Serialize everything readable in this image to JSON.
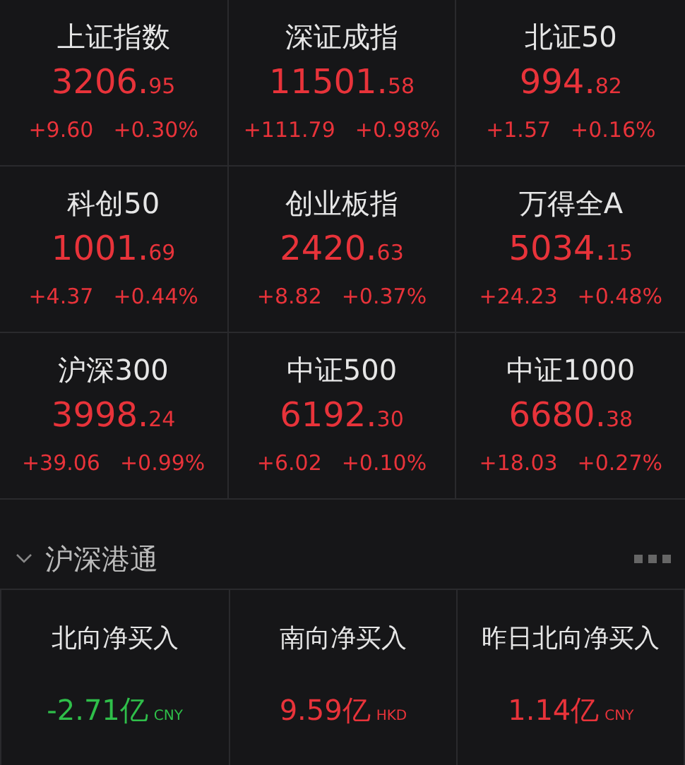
{
  "indices": [
    {
      "name": "上证指数",
      "price_int": "3206.",
      "price_dec": "95",
      "change": "+9.60",
      "percent": "+0.30%",
      "color": "#e8333a"
    },
    {
      "name": "深证成指",
      "price_int": "11501.",
      "price_dec": "58",
      "change": "+111.79",
      "percent": "+0.98%",
      "color": "#e8333a"
    },
    {
      "name": "北证50",
      "price_int": "994.",
      "price_dec": "82",
      "change": "+1.57",
      "percent": "+0.16%",
      "color": "#e8333a"
    },
    {
      "name": "科创50",
      "price_int": "1001.",
      "price_dec": "69",
      "change": "+4.37",
      "percent": "+0.44%",
      "color": "#e8333a"
    },
    {
      "name": "创业板指",
      "price_int": "2420.",
      "price_dec": "63",
      "change": "+8.82",
      "percent": "+0.37%",
      "color": "#e8333a"
    },
    {
      "name": "万得全A",
      "price_int": "5034.",
      "price_dec": "15",
      "change": "+24.23",
      "percent": "+0.48%",
      "color": "#e8333a"
    },
    {
      "name": "沪深300",
      "price_int": "3998.",
      "price_dec": "24",
      "change": "+39.06",
      "percent": "+0.99%",
      "color": "#e8333a"
    },
    {
      "name": "中证500",
      "price_int": "6192.",
      "price_dec": "30",
      "change": "+6.02",
      "percent": "+0.10%",
      "color": "#e8333a"
    },
    {
      "name": "中证1000",
      "price_int": "6680.",
      "price_dec": "38",
      "change": "+18.03",
      "percent": "+0.27%",
      "color": "#e8333a"
    }
  ],
  "section": {
    "title": "沪深港通",
    "expanded": true
  },
  "flows": [
    {
      "label": "北向净买入",
      "value": "-2.71亿",
      "currency": "CNY",
      "color": "#2fbf4a"
    },
    {
      "label": "南向净买入",
      "value": "9.59亿",
      "currency": "HKD",
      "color": "#e8333a"
    },
    {
      "label": "昨日北向净买入",
      "value": "1.14亿",
      "currency": "CNY",
      "color": "#e8333a"
    }
  ]
}
